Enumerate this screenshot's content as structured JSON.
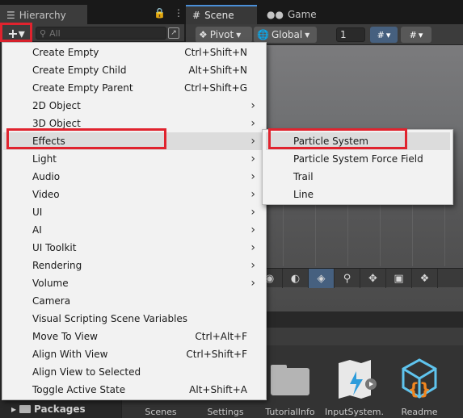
{
  "tabs": {
    "hierarchy": "Hierarchy",
    "scene": "Scene",
    "game": "Game"
  },
  "hierarchy": {
    "add_button": "+▾",
    "search_placeholder": "All"
  },
  "scene_toolbar": {
    "pivot": "Pivot",
    "global": "Global",
    "grid_value": "1"
  },
  "menu": {
    "items": [
      {
        "label": "Create Empty",
        "shortcut": "Ctrl+Shift+N",
        "submenu": false
      },
      {
        "label": "Create Empty Child",
        "shortcut": "Alt+Shift+N",
        "submenu": false
      },
      {
        "label": "Create Empty Parent",
        "shortcut": "Ctrl+Shift+G",
        "submenu": false
      },
      {
        "label": "2D Object",
        "shortcut": "",
        "submenu": true
      },
      {
        "label": "3D Object",
        "shortcut": "",
        "submenu": true
      },
      {
        "label": "Effects",
        "shortcut": "",
        "submenu": true
      },
      {
        "label": "Light",
        "shortcut": "",
        "submenu": true
      },
      {
        "label": "Audio",
        "shortcut": "",
        "submenu": true
      },
      {
        "label": "Video",
        "shortcut": "",
        "submenu": true
      },
      {
        "label": "UI",
        "shortcut": "",
        "submenu": true
      },
      {
        "label": "AI",
        "shortcut": "",
        "submenu": true
      },
      {
        "label": "UI Toolkit",
        "shortcut": "",
        "submenu": true
      },
      {
        "label": "Rendering",
        "shortcut": "",
        "submenu": true
      },
      {
        "label": "Volume",
        "shortcut": "",
        "submenu": true
      },
      {
        "label": "Camera",
        "shortcut": "",
        "submenu": false
      },
      {
        "label": "Visual Scripting Scene Variables",
        "shortcut": "",
        "submenu": false
      },
      {
        "label": "Move To View",
        "shortcut": "Ctrl+Alt+F",
        "submenu": false
      },
      {
        "label": "Align With View",
        "shortcut": "Ctrl+Shift+F",
        "submenu": false
      },
      {
        "label": "Align View to Selected",
        "shortcut": "",
        "submenu": false
      },
      {
        "label": "Toggle Active State",
        "shortcut": "Alt+Shift+A",
        "submenu": false
      }
    ],
    "arrow": "›"
  },
  "effects_submenu": {
    "items": [
      "Particle System",
      "Particle System Force Field",
      "Trail",
      "Line"
    ]
  },
  "packages_label": "Packages",
  "assets": [
    "Scenes",
    "Settings",
    "TutorialInfo",
    "InputSystem...",
    "Readme"
  ],
  "colors": {
    "highlight_red": "#e0232e",
    "menu_bg": "#f2f2f2",
    "active_blue": "#46607f"
  }
}
